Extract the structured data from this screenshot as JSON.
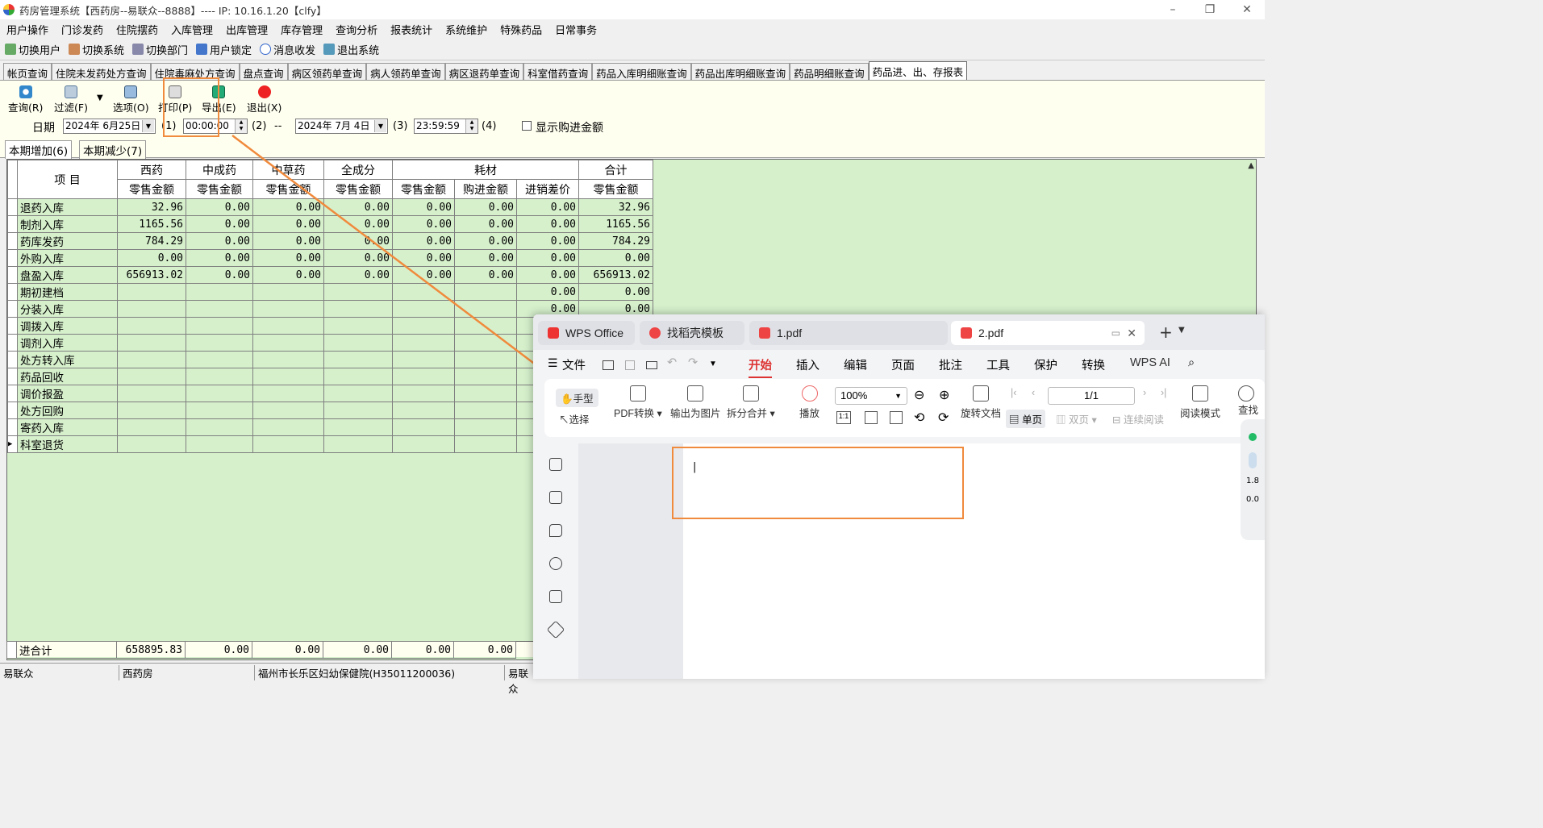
{
  "window": {
    "title": "药房管理系统【西药房--易联众--8888】---- IP: 10.16.1.20【clfy】"
  },
  "menu": [
    "用户操作",
    "门诊发药",
    "住院摆药",
    "入库管理",
    "出库管理",
    "库存管理",
    "查询分析",
    "报表统计",
    "系统维护",
    "特殊药品",
    "日常事务"
  ],
  "toolbar": [
    "切换用户",
    "切换系统",
    "切换部门",
    "用户锁定",
    "消息收发",
    "退出系统"
  ],
  "tabs": [
    "帐页查询",
    "住院未发药处方查询",
    "住院毒麻处方查询",
    "盘点查询",
    "病区领药单查询",
    "病人领药单查询",
    "病区退药单查询",
    "科室借药查询",
    "药品入库明细账查询",
    "药品出库明细账查询",
    "药品明细账查询",
    "药品进、出、存报表"
  ],
  "actions": {
    "query": "查询(R)",
    "filter": "过滤(F)",
    "options": "选项(O)",
    "print": "打印(P)",
    "export": "导出(E)",
    "exit": "退出(X)"
  },
  "form": {
    "date_label": "日期",
    "start_date": "2024年 6月25日",
    "k1": "(1)",
    "start_time": "00:00:00",
    "k2": "(2)",
    "dash": "--",
    "end_date": "2024年 7月 4日",
    "k3": "(3)",
    "end_time": "23:59:59",
    "k4": "(4)",
    "show_purchase": "显示购进金额"
  },
  "subtabs": [
    "本期增加(6)",
    "本期减少(7)"
  ],
  "grid": {
    "item_header": "项  目",
    "groups": [
      "西药",
      "中成药",
      "中草药",
      "全成分",
      "耗材",
      "合计"
    ],
    "subheaders": [
      "零售金额",
      "零售金额",
      "零售金额",
      "零售金额",
      "零售金额",
      "购进金额",
      "进销差价",
      "零售金额"
    ],
    "rows": [
      [
        "退药入库",
        "32.96",
        "0.00",
        "0.00",
        "0.00",
        "0.00",
        "0.00",
        "0.00",
        "32.96"
      ],
      [
        "制剂入库",
        "1165.56",
        "0.00",
        "0.00",
        "0.00",
        "0.00",
        "0.00",
        "0.00",
        "1165.56"
      ],
      [
        "药库发药",
        "784.29",
        "0.00",
        "0.00",
        "0.00",
        "0.00",
        "0.00",
        "0.00",
        "784.29"
      ],
      [
        "外购入库",
        "0.00",
        "0.00",
        "0.00",
        "0.00",
        "0.00",
        "0.00",
        "0.00",
        "0.00"
      ],
      [
        "盘盈入库",
        "656913.02",
        "0.00",
        "0.00",
        "0.00",
        "0.00",
        "0.00",
        "0.00",
        "656913.02"
      ],
      [
        "期初建档",
        "",
        "",
        "",
        "",
        "",
        "",
        "0.00",
        "0.00"
      ],
      [
        "分装入库",
        "",
        "",
        "",
        "",
        "",
        "",
        "0.00",
        "0.00"
      ],
      [
        "调拨入库",
        "",
        "",
        "",
        "",
        "",
        "",
        "",
        ""
      ],
      [
        "调剂入库",
        "",
        "",
        "",
        "",
        "",
        "",
        "",
        ""
      ],
      [
        "处方转入库",
        "",
        "",
        "",
        "",
        "",
        "",
        "",
        ""
      ],
      [
        "药品回收",
        "",
        "",
        "",
        "",
        "",
        "",
        "",
        ""
      ],
      [
        "调价报盈",
        "",
        "",
        "",
        "",
        "",
        "",
        "",
        ""
      ],
      [
        "处方回购",
        "",
        "",
        "",
        "",
        "",
        "",
        "",
        ""
      ],
      [
        "寄药入库",
        "",
        "",
        "",
        "",
        "",
        "",
        "",
        ""
      ],
      [
        "科室退货",
        "",
        "",
        "",
        "",
        "",
        "",
        "",
        ""
      ]
    ],
    "total": [
      "进合计",
      "658895.83",
      "0.00",
      "0.00",
      "0.00",
      "0.00",
      "0.00"
    ]
  },
  "status": [
    "易联众",
    "西药房",
    "福州市长乐区妇幼保健院(H35011200036)",
    "易联众"
  ],
  "wps": {
    "tabs": [
      "WPS Office",
      "找稻壳模板",
      "1.pdf",
      "2.pdf"
    ],
    "menu": [
      "文件",
      "开始",
      "插入",
      "编辑",
      "页面",
      "批注",
      "工具",
      "保护",
      "转换",
      "WPS AI"
    ],
    "ribbon": {
      "hand": "手型",
      "select": "选择",
      "pdf_convert": "PDF转换",
      "export_img": "输出为图片",
      "split_merge": "拆分合并",
      "play": "播放",
      "zoom": "100%",
      "page": "1/1",
      "rotate": "旋转文档",
      "single": "单页",
      "double": "双页",
      "continuous": "连续阅读",
      "read_mode": "阅读模式",
      "find": "查找"
    },
    "side_speed1": "1.8",
    "side_speed2": "0.0"
  }
}
